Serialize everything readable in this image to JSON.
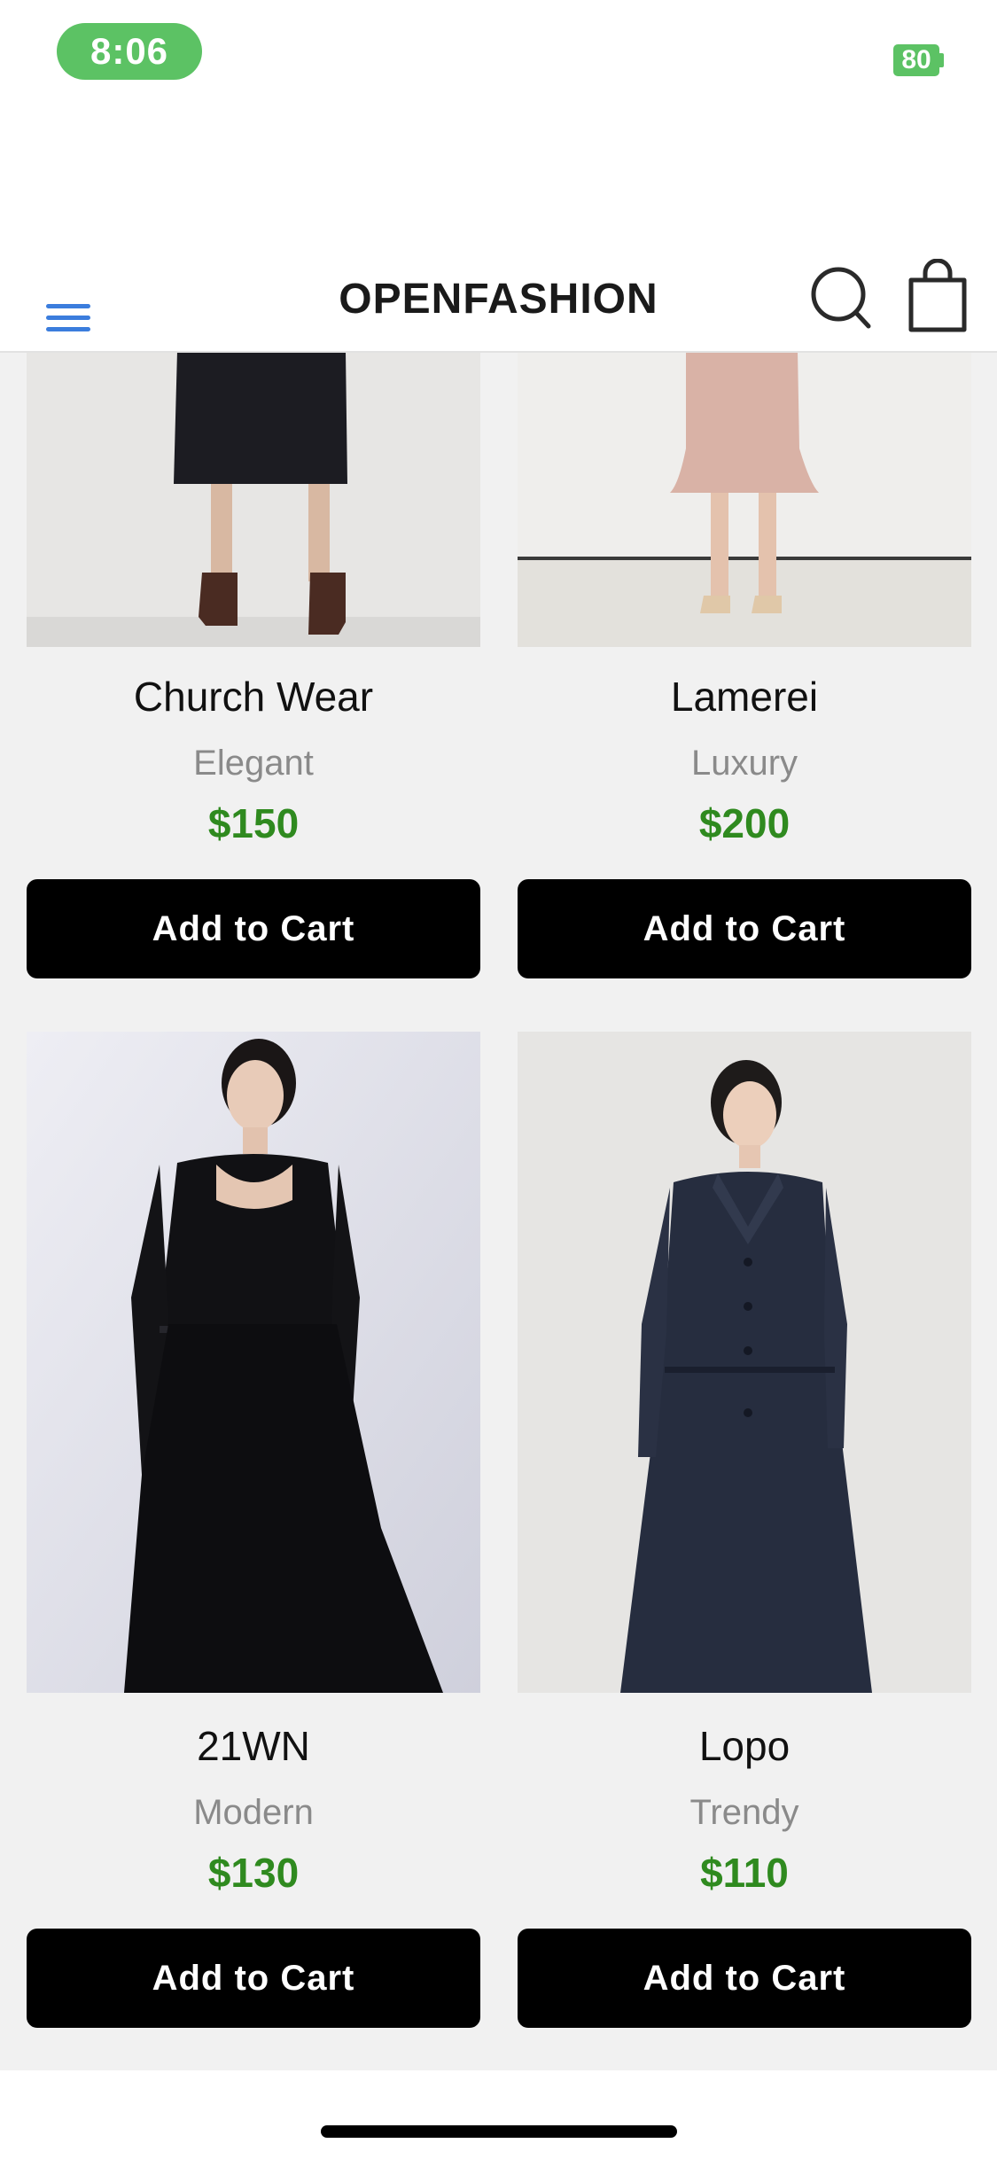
{
  "status_bar": {
    "time": "8:06",
    "battery": "80"
  },
  "header": {
    "title": "OPENFASHION",
    "menu_icon": "hamburger-menu-icon",
    "search_icon": "search-icon",
    "cart_icon": "shopping-bag-icon",
    "accent_color": "#3b7ddd"
  },
  "products": [
    {
      "name": "Church Wear",
      "category": "Elegant",
      "price": "$150",
      "button": "Add to Cart"
    },
    {
      "name": "Lamerei",
      "category": "Luxury",
      "price": "$200",
      "button": "Add to Cart"
    },
    {
      "name": "21WN",
      "category": "Modern",
      "price": "$130",
      "button": "Add to Cart"
    },
    {
      "name": "Lopo",
      "category": "Trendy",
      "price": "$110",
      "button": "Add to Cart"
    }
  ],
  "colors": {
    "price_green": "#2f8a1f",
    "status_green": "#5cc264",
    "button_black": "#000000"
  }
}
